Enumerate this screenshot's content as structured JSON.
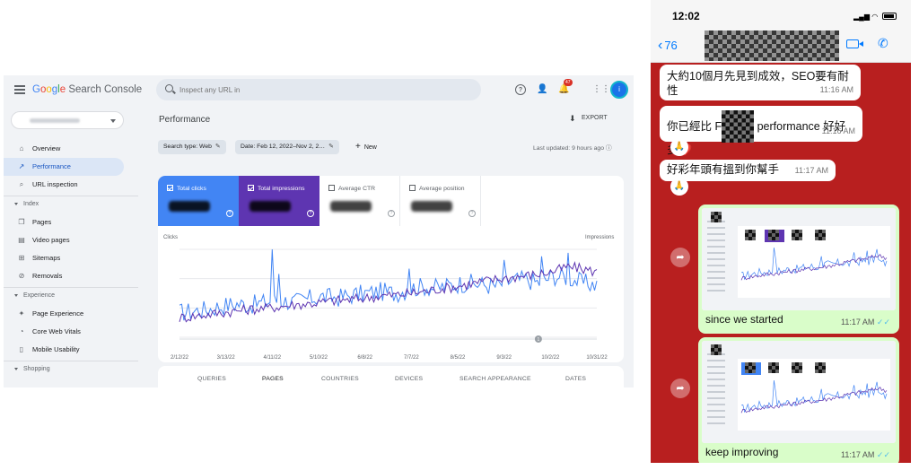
{
  "gsc": {
    "logo": {
      "google": "Google",
      "product": "Search Console"
    },
    "search": {
      "placeholder": "Inspect any URL in"
    },
    "notification_count": "47",
    "avatar_initial": "i",
    "sidebar": {
      "items": [
        {
          "label": "Overview",
          "icon": "home-icon",
          "active": false
        },
        {
          "label": "Performance",
          "icon": "trending-icon",
          "active": true
        },
        {
          "label": "URL inspection",
          "icon": "search-icon",
          "active": false
        }
      ],
      "sections": [
        {
          "title": "Index",
          "items": [
            {
              "label": "Pages",
              "icon": "pages-icon"
            },
            {
              "label": "Video pages",
              "icon": "video-pages-icon"
            },
            {
              "label": "Sitemaps",
              "icon": "sitemap-icon"
            },
            {
              "label": "Removals",
              "icon": "removals-icon"
            }
          ]
        },
        {
          "title": "Experience",
          "items": [
            {
              "label": "Page Experience",
              "icon": "page-experience-icon"
            },
            {
              "label": "Core Web Vitals",
              "icon": "gauge-icon"
            },
            {
              "label": "Mobile Usability",
              "icon": "mobile-icon"
            }
          ]
        },
        {
          "title": "Shopping",
          "items": []
        }
      ]
    },
    "page_title": "Performance",
    "export_label": "EXPORT",
    "filters": {
      "search_type": "Search type: Web",
      "date": "Date: Feb 12, 2022–Nov 2, 2…",
      "new": "New"
    },
    "last_updated": "Last updated: 9 hours ago",
    "metrics": [
      {
        "label": "Total clicks",
        "checked": true,
        "color": "#4285f4"
      },
      {
        "label": "Total impressions",
        "checked": true,
        "color": "#5e35b1"
      },
      {
        "label": "Average CTR",
        "checked": false
      },
      {
        "label": "Average position",
        "checked": false
      }
    ],
    "tabs": [
      "QUERIES",
      "PAGES",
      "COUNTRIES",
      "DEVICES",
      "SEARCH APPEARANCE",
      "DATES"
    ],
    "active_tab": "PAGES"
  },
  "chart_data": {
    "type": "line",
    "left_axis_label": "Clicks",
    "right_axis_label": "Impressions",
    "x_tick_labels": [
      "2/12/22",
      "3/13/22",
      "4/11/22",
      "5/10/22",
      "6/8/22",
      "7/7/22",
      "8/5/22",
      "9/3/22",
      "10/2/22",
      "10/31/22"
    ],
    "ylim": [
      0,
      1
    ],
    "grid": true,
    "annotation_marker": "1",
    "series": [
      {
        "name": "Total clicks",
        "color": "#4285f4",
        "trend": [
          0.28,
          0.3,
          0.32,
          0.36,
          0.38,
          0.37,
          0.4,
          0.42,
          0.4,
          0.44,
          0.46,
          0.45,
          0.48,
          0.5,
          0.52,
          0.5,
          0.55,
          0.58,
          0.56,
          0.6,
          0.62,
          0.6,
          0.58,
          0.64,
          0.66,
          0.62,
          0.7,
          0.68,
          0.62,
          0.6
        ],
        "spikes": [
          [
            0.22,
            1.0
          ],
          [
            0.24,
            0.72
          ],
          [
            0.55,
            0.78
          ],
          [
            0.78,
            0.88
          ],
          [
            0.87,
            0.92
          ],
          [
            0.93,
            0.96
          ]
        ]
      },
      {
        "name": "Total impressions",
        "color": "#5e35b1",
        "trend": [
          0.22,
          0.24,
          0.26,
          0.28,
          0.3,
          0.32,
          0.33,
          0.35,
          0.37,
          0.38,
          0.4,
          0.42,
          0.43,
          0.45,
          0.47,
          0.48,
          0.5,
          0.52,
          0.55,
          0.57,
          0.6,
          0.63,
          0.66,
          0.68,
          0.7,
          0.72,
          0.75,
          0.8,
          0.78,
          0.74
        ]
      }
    ]
  },
  "chat": {
    "time": "12:02",
    "back_count": "76",
    "messages": [
      {
        "text": "大約10個月先見到成效，SEO要有耐性",
        "time": "11:16 AM"
      },
      {
        "text_before": "你已經比 F",
        "text_after": " performance 好好多❤️",
        "time": "11:16 AM"
      },
      {
        "text": "好彩年頭有搵到你幫手",
        "time": "11:17 AM"
      }
    ],
    "reaction": "🙏",
    "image_messages": [
      {
        "caption": "since we started",
        "time": "11:17 AM"
      },
      {
        "caption": "keep improving",
        "time": "11:17 AM"
      }
    ]
  }
}
